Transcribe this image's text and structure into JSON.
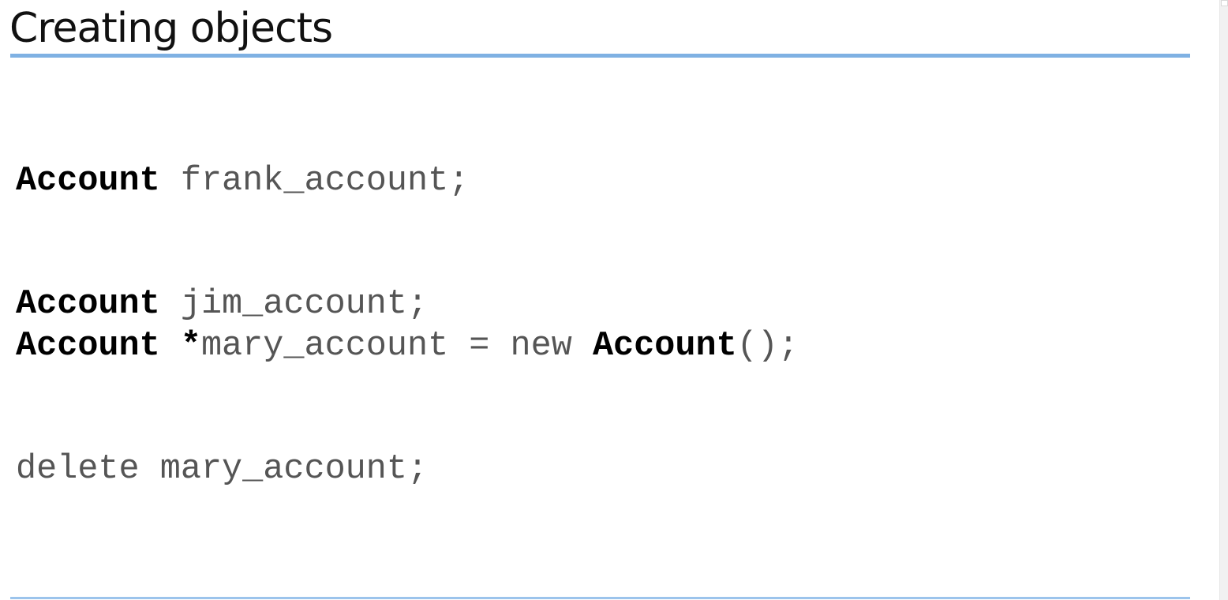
{
  "slide": {
    "title": "Creating objects",
    "accent_color": "#7fb1e3"
  },
  "code": {
    "block_1": [
      {
        "type": "Account",
        "rest": " frank_account;"
      },
      {
        "type": "Account",
        "rest": " jim_account;"
      }
    ],
    "block_2": {
      "line_1": {
        "type": "Account",
        "star": " *",
        "mid": "mary_account = new ",
        "ctor": "Account",
        "tail": "();"
      },
      "line_2": {
        "text": "delete mary_account;"
      }
    }
  }
}
